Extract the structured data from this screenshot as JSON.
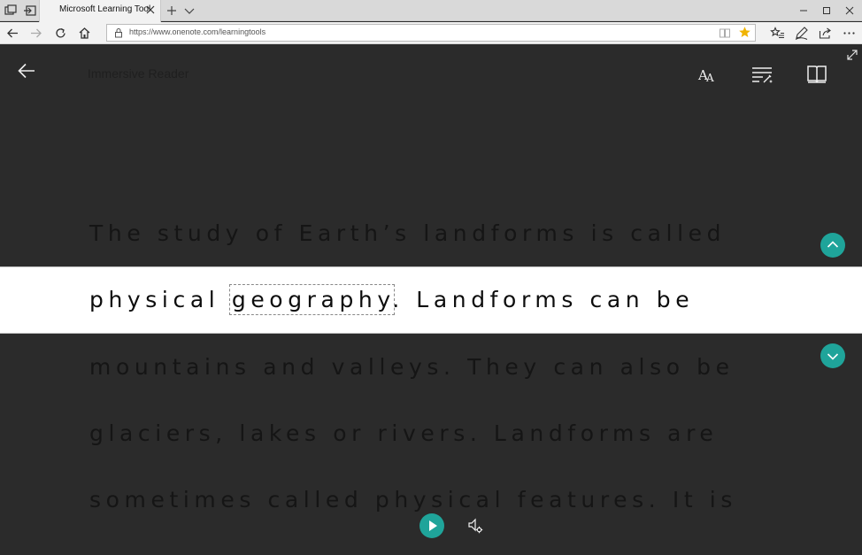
{
  "browser": {
    "tab_title": "Microsoft Learning Tool",
    "url": "https://www.onenote.com/learningtools"
  },
  "reader": {
    "title": "Immersive Reader",
    "lines": [
      "The study of Earth’s landforms is called",
      "physical ",
      "geography",
      ". Landforms can be",
      "mountains and valleys. They can also be",
      "glaciers, lakes or rivers. Landforms are",
      "sometimes called physical features. It is"
    ]
  },
  "colors": {
    "accent": "#1fa49a",
    "reader_bg": "#2b2b2b",
    "focus_band": "#ffffff",
    "favorite_star": "#f0b400"
  },
  "icons": [
    "tab-preview-icon",
    "set-aside-tabs-icon",
    "close-icon",
    "plus-icon",
    "chevron-down-icon",
    "minimize-icon",
    "maximize-icon",
    "close-window-icon",
    "back-icon",
    "forward-icon",
    "refresh-icon",
    "home-icon",
    "lock-icon",
    "reading-view-icon",
    "star-icon",
    "favorites-icon",
    "pen-icon",
    "share-icon",
    "more-icon",
    "arrow-left-icon",
    "text-preferences-icon",
    "grammar-options-icon",
    "book-icon",
    "expand-icon",
    "chevron-up-icon",
    "play-icon",
    "speaker-settings-icon"
  ]
}
